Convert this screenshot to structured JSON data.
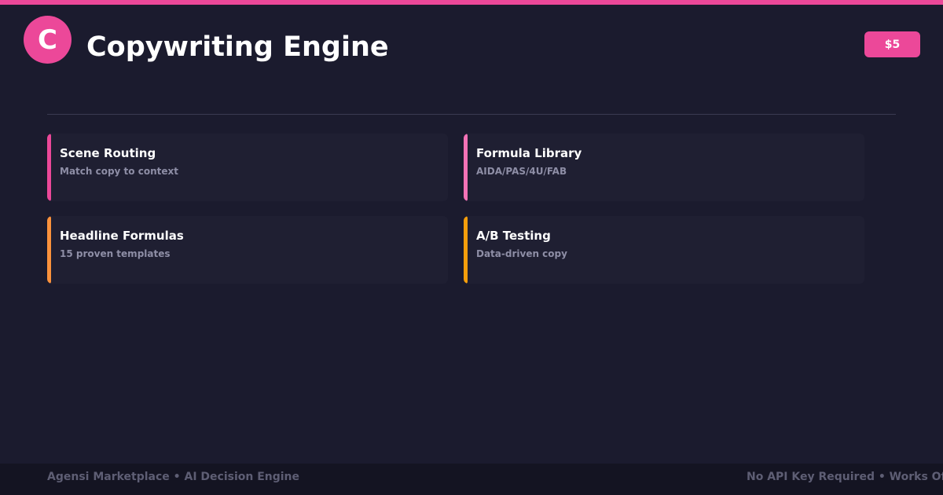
{
  "header": {
    "logo_letter": "C",
    "title": "Copywriting Engine",
    "price": "$5"
  },
  "colors": {
    "brand": "#ec4899",
    "background": "#1b1b2e",
    "card": "#1f1f32",
    "accent_pink": "#ec4899",
    "accent_light_pink": "#f472b6",
    "accent_orange": "#fb923c",
    "accent_amber": "#f59e0b"
  },
  "cards": [
    {
      "title": "Scene Routing",
      "subtitle": "Match copy to context"
    },
    {
      "title": "Formula Library",
      "subtitle": "AIDA/PAS/4U/FAB"
    },
    {
      "title": "Headline Formulas",
      "subtitle": "15 proven templates"
    },
    {
      "title": "A/B Testing",
      "subtitle": "Data-driven copy"
    }
  ],
  "footer": {
    "left": "Agensi Marketplace • AI Decision Engine",
    "right": "No API Key Required • Works Offline"
  }
}
